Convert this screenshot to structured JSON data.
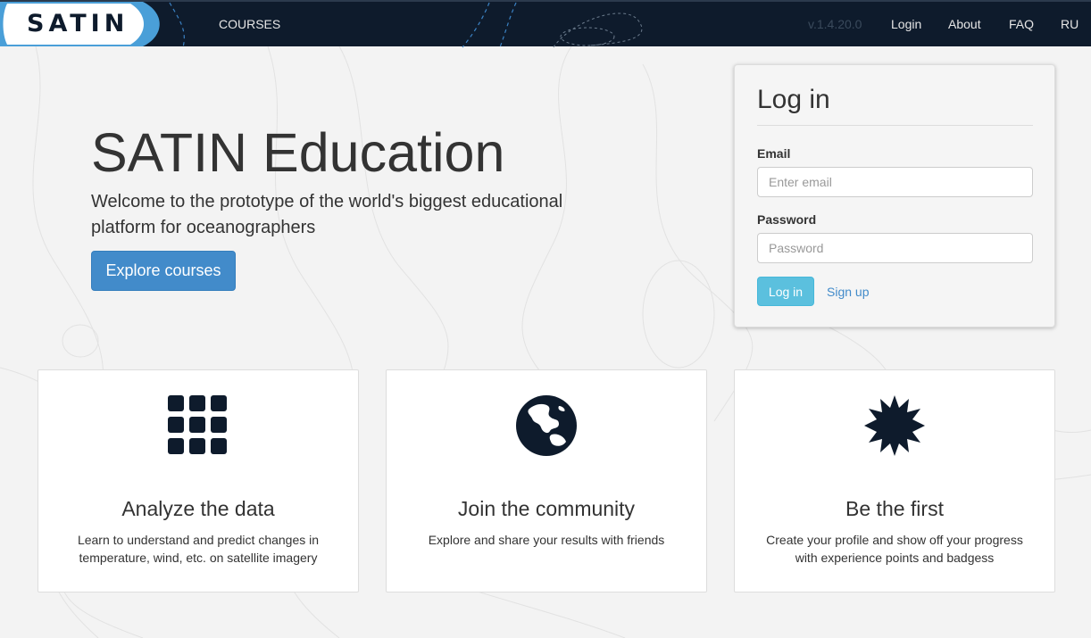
{
  "navbar": {
    "logo": "SATIN",
    "courses": "COURSES",
    "version": "v.1.4.20.0",
    "login": "Login",
    "about": "About",
    "faq": "FAQ",
    "language": "RU"
  },
  "hero": {
    "title": "SATIN Education",
    "subtitle": "Welcome to the prototype of the world's biggest educational platform for oceanographers",
    "explore_button": "Explore courses"
  },
  "login": {
    "title": "Log in",
    "email_label": "Email",
    "email_placeholder": "Enter email",
    "email_value": "",
    "password_label": "Password",
    "password_placeholder": "Password",
    "password_value": "",
    "submit_button": "Log in",
    "signup_link": "Sign up"
  },
  "features": [
    {
      "icon": "grid-icon",
      "title": "Analyze the data",
      "description": "Learn to understand and predict changes in temperature, wind, etc. on satellite imagery"
    },
    {
      "icon": "globe-icon",
      "title": "Join the community",
      "description": "Explore and share your results with friends"
    },
    {
      "icon": "star-burst-icon",
      "title": "Be the first",
      "description": "Create your profile and show off your progress with experience points and badgess"
    }
  ],
  "colors": {
    "navbar_bg": "#0e1b2c",
    "logo_accent": "#4a9fd8",
    "primary": "#428bca",
    "info": "#5bc0de",
    "page_bg": "#f3f3f3"
  }
}
